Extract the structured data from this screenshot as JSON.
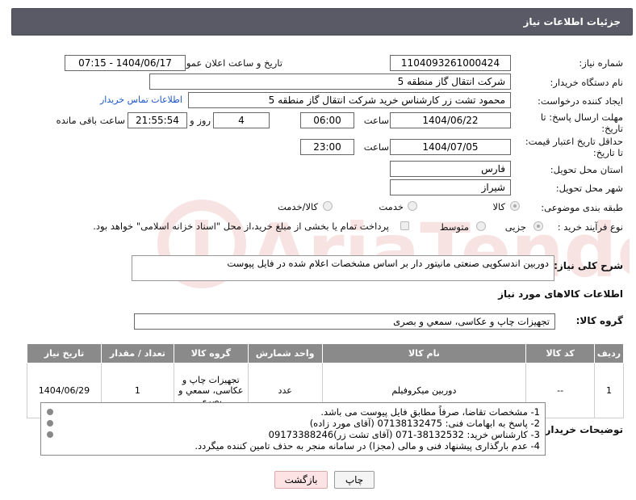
{
  "header": {
    "title": "جزئیات اطلاعات نیاز"
  },
  "fields": {
    "need_number_label": "شماره نیاز:",
    "need_number": "1104093261000424",
    "announce_label": "تاریخ و ساعت اعلان عمومی:",
    "announce_value": "1404/06/17 - 07:15",
    "buyer_label": "نام دستگاه خریدار:",
    "buyer_value": "شرکت انتقال گاز منطقه 5",
    "creator_label": "ایجاد کننده درخواست:",
    "creator_value": "محمود تشت زر کارشناس خرید شرکت انتقال گاز منطقه 5",
    "contact_link": "اطلاعات تماس خریدار",
    "reply_deadline_label_1": "مهلت ارسال پاسخ: تا",
    "reply_deadline_label_2": "تاریخ:",
    "reply_date": "1404/06/22",
    "hour_label": "ساعت",
    "reply_time": "06:00",
    "days_value": "4",
    "days_label": "روز و",
    "remaining_time": "21:55:54",
    "remaining_label": "ساعت باقی مانده",
    "price_validity_label_1": "حداقل تاریخ اعتبار قیمت:",
    "price_validity_label_2": "تا تاریخ:",
    "price_date": "1404/07/05",
    "price_hour_label": "ساعت",
    "price_time": "23:00",
    "province_label": "استان محل تحویل:",
    "province_value": "فارس",
    "city_label": "شهر محل تحویل:",
    "city_value": "شیراز",
    "category_label": "طبقه بندی موضوعی:",
    "category_options": [
      "کالا",
      "خدمت",
      "کالا/خدمت"
    ],
    "purchase_type_label": "نوع فرآیند خرید :",
    "purchase_options": [
      "جزیی",
      "متوسط"
    ],
    "payment_note": "پرداخت تمام یا بخشی از مبلغ خرید،از محل \"اسناد خزانه اسلامی\" خواهد بود.",
    "description_label": "شرح کلی نیاز:",
    "description_value": "دوربین اندسکوپی صنعتی مانیتور دار بر اساس مشخصات اعلام شده در فایل پیوست",
    "goods_section_title": "اطلاعات کالاهای مورد نیاز",
    "goods_group_label": "گروه کالا:",
    "goods_group_value": "تجهیزات چاپ و عکاسی، سمعي و بصری"
  },
  "table": {
    "headers": [
      "ردیف",
      "کد کالا",
      "نام کالا",
      "واحد شمارش",
      "گروه کالا",
      "تعداد / مقدار",
      "تاریخ نیاز"
    ],
    "rows": [
      [
        "1",
        "--",
        "دوربین میکروفیلم",
        "عدد",
        "تجهیزات چاپ و عکاسی، سمعي و بصری",
        "1",
        "1404/06/29"
      ]
    ]
  },
  "notes": {
    "label": "توضیحات خریدار:",
    "lines": [
      "1-  مشخصات تقاضا، صرفاً مطابق فایل پیوست می باشد.",
      "2- پاسخ به ابهامات فنی: 07138132475 (آقای مورد زاده)",
      "3- کارشناس خرید: 38132532-071 (آقای تشت زر)09173388246",
      "4- عدم بارگذاری پیشنهاد فنی و مالی (مجزا) در سامانه منجر به حذف تامین کننده میگردد."
    ]
  },
  "buttons": {
    "print": "چاپ",
    "back": "بازگشت"
  },
  "watermark": {
    "text": "AriaTender.net"
  },
  "colors": {
    "header": "#5a5a66",
    "link": "#1a55c8",
    "table_header": "#8a8a8a",
    "back_button": "#fde3e3"
  }
}
